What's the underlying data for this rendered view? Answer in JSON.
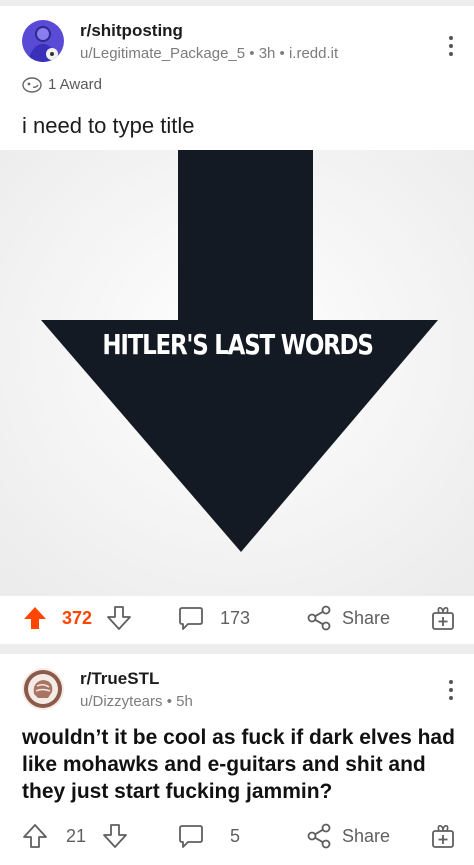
{
  "posts": [
    {
      "subreddit": "r/shitposting",
      "byline": "u/Legitimate_Package_5 • 3h • i.redd.it",
      "award": "1 Award",
      "title": "i need to type title",
      "image_text": "HITLER'S LAST WORDS",
      "votes": "372",
      "vote_state": "upvoted",
      "comments": "173",
      "share_label": "Share"
    },
    {
      "subreddit": "r/TrueSTL",
      "byline": "u/Dizzytears • 5h",
      "title": "wouldn’t it be cool as fuck if dark elves had like mohawks and e-guitars and shit and they just start fucking jammin?",
      "votes": "21",
      "comments": "5",
      "share_label": "Share"
    }
  ],
  "colors": {
    "upvote": "#ff4500",
    "icon": "#5f5f5f",
    "meta": "#7c7c7c",
    "arrow": "#141a24"
  }
}
